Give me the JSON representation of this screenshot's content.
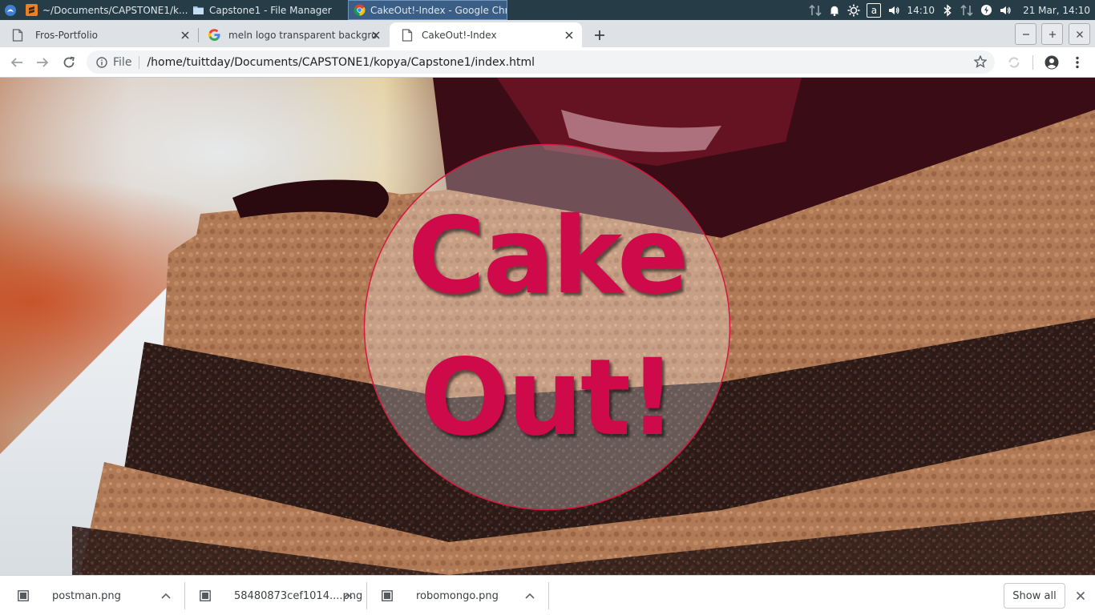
{
  "taskbar": {
    "tasks": [
      {
        "label": "~/Documents/CAPSTONE1/k...",
        "icon": "sublime-text-icon"
      },
      {
        "label": "Capstone1 - File Manager",
        "icon": "folder-icon"
      },
      {
        "label": "CakeOut!-Index - Google Chr...",
        "icon": "chrome-icon",
        "active": true
      }
    ],
    "time": "14:10",
    "date_time": "21 Mar, 14:10",
    "keyboard_layout": "a"
  },
  "browser": {
    "tabs": [
      {
        "label": "Fros-Portfolio",
        "icon": "page-icon"
      },
      {
        "label": "meln logo transparent backgro",
        "icon": "google-icon"
      },
      {
        "label": "CakeOut!-Index",
        "icon": "page-icon",
        "active": true
      }
    ],
    "omnibox": {
      "scheme": "File",
      "url": "/home/tuittday/Documents/CAPSTONE1/kopya/Capstone1/index.html"
    }
  },
  "page": {
    "logo_line1": "Cake",
    "logo_line2": "Out!"
  },
  "downloads": {
    "items": [
      {
        "name": "postman.png"
      },
      {
        "name": "58480873cef1014....png"
      },
      {
        "name": "robomongo.png"
      }
    ],
    "show_all_label": "Show all"
  },
  "colors": {
    "taskbar_bg": "#263d48",
    "logo_red": "#cf0a4a",
    "tab_strip_bg": "#dee1e6"
  }
}
